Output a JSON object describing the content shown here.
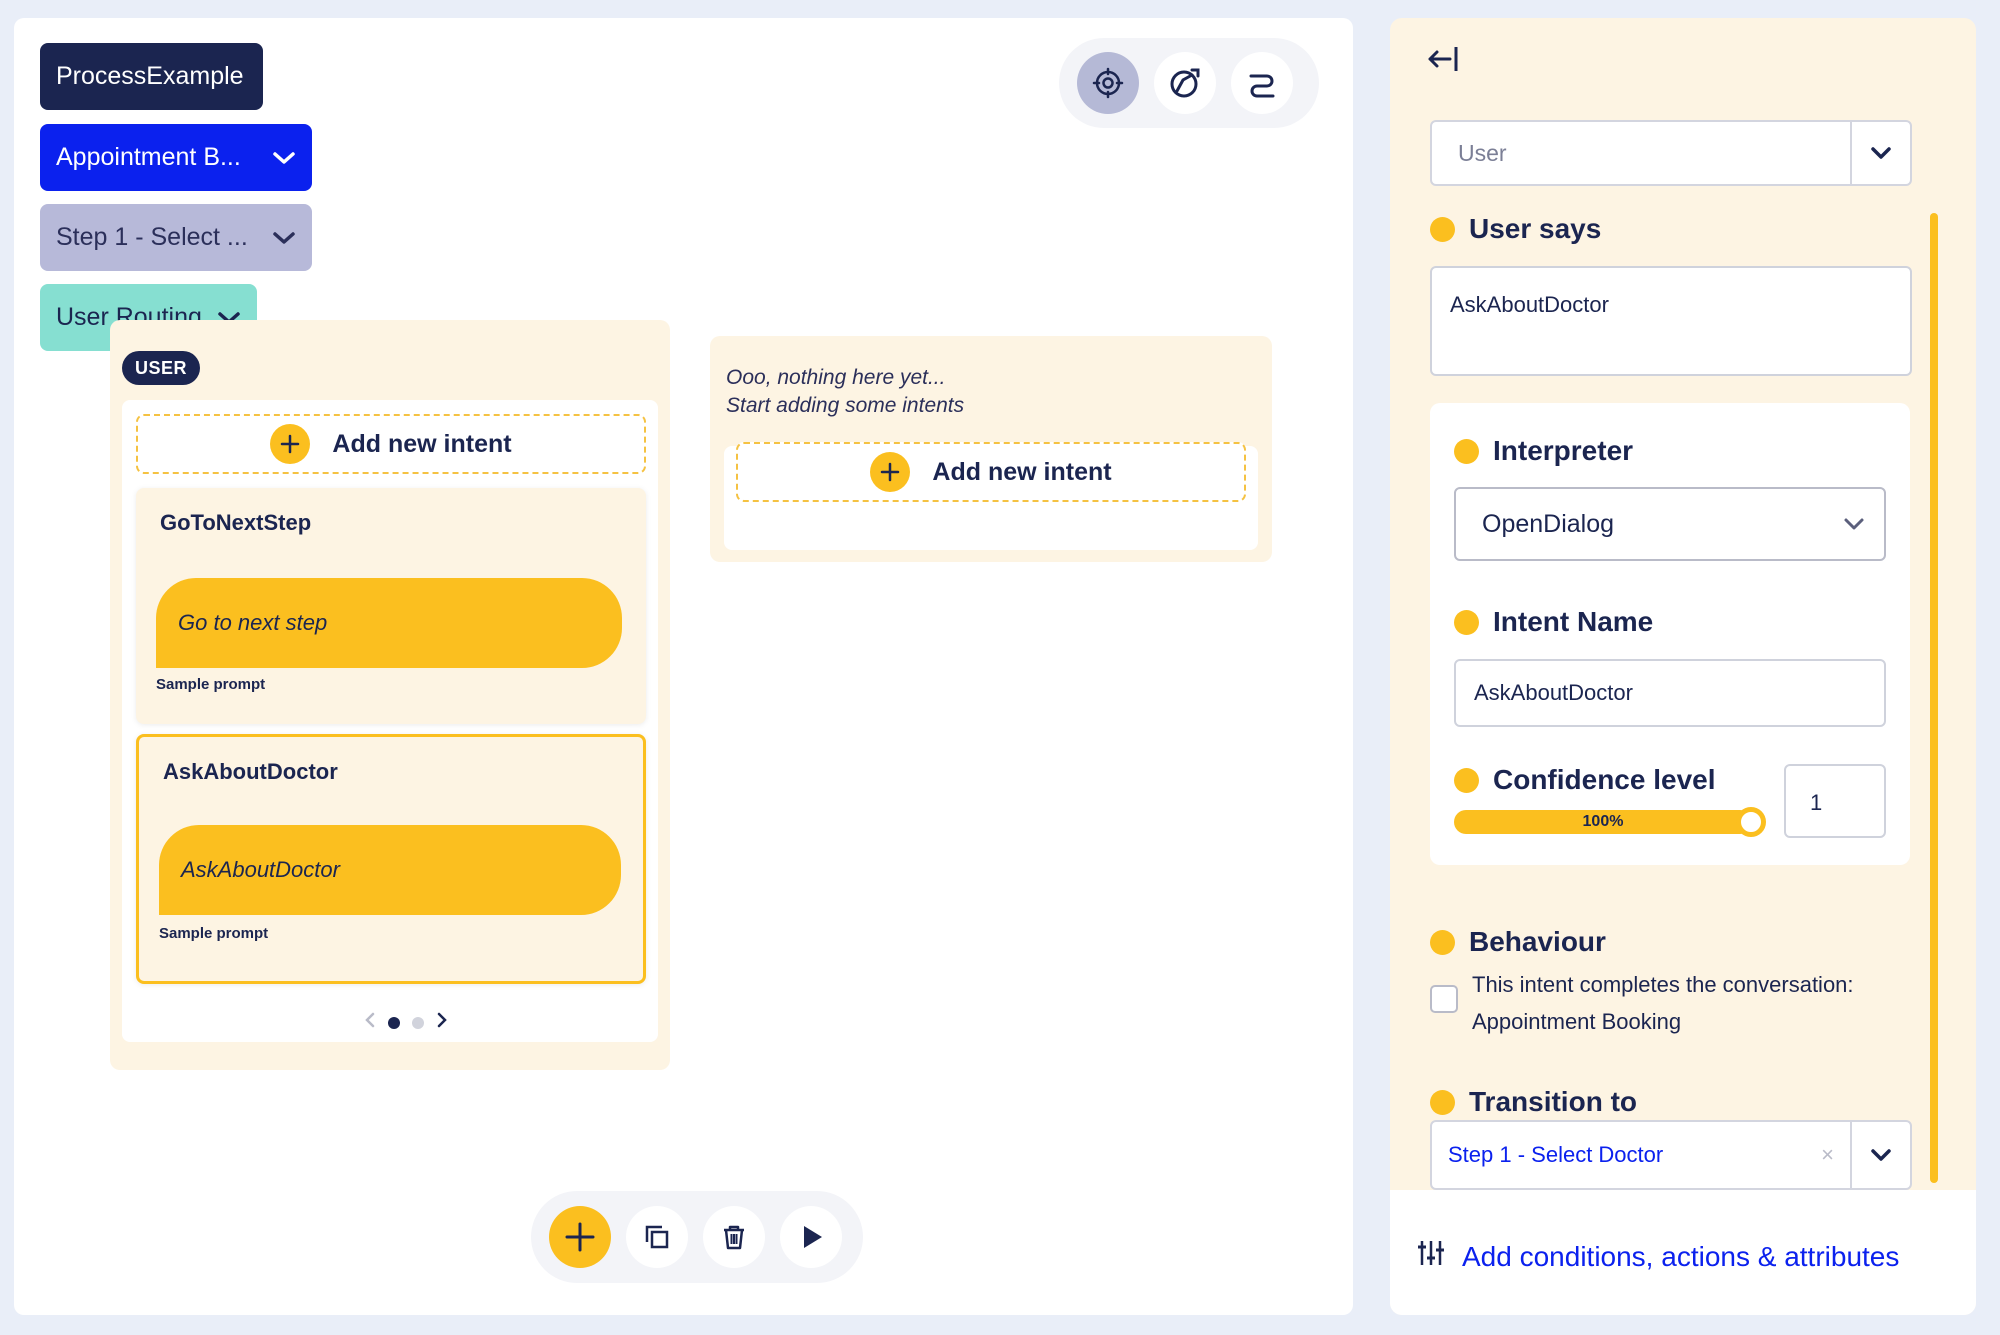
{
  "breadcrumbs": {
    "process": "ProcessExample",
    "scenario": "Appointment B...",
    "step": "Step 1 - Select ...",
    "routing": "User Routing"
  },
  "view_toggle": {
    "icons": [
      "settings-icon",
      "compass-icon",
      "path-icon"
    ],
    "active": "settings-icon"
  },
  "user_column": {
    "badge": "USER",
    "add_label": "Add new intent",
    "intents": [
      {
        "name": "GoToNextStep",
        "prompt": "Go to next step",
        "caption": "Sample prompt"
      },
      {
        "name": "AskAboutDoctor",
        "prompt": "AskAboutDoctor",
        "caption": "Sample prompt"
      }
    ],
    "pager": {
      "current": 1,
      "total": 2
    }
  },
  "empty_column": {
    "message_line1": "Ooo, nothing here yet...",
    "message_line2": "Start adding some intents",
    "add_label": "Add new intent"
  },
  "toolbar": {
    "icons": [
      "plus-icon",
      "duplicate-icon",
      "trash-icon",
      "play-icon"
    ]
  },
  "side_panel": {
    "speaker_select": "User",
    "user_says_label": "User says",
    "user_says_value": "AskAboutDoctor",
    "interpreter_label": "Interpreter",
    "interpreter_value": "OpenDialog",
    "intent_name_label": "Intent Name",
    "intent_name_value": "AskAboutDoctor",
    "confidence_label": "Confidence level",
    "confidence_percent": "100%",
    "confidence_value": "1",
    "behaviour_label": "Behaviour",
    "behaviour_text_line1": "This intent completes the conversation:",
    "behaviour_text_line2": "Appointment Booking",
    "behaviour_checked": false,
    "transition_label": "Transition to",
    "transition_value": "Step 1 - Select Doctor",
    "add_conditions": "Add conditions, actions & attributes"
  },
  "colors": {
    "navy": "#1b2550",
    "blue": "#0b21ee",
    "yellow": "#fbbf1f",
    "cream": "#fdf4e3",
    "lavender": "#b7b9d9",
    "teal": "#86dfd1"
  }
}
